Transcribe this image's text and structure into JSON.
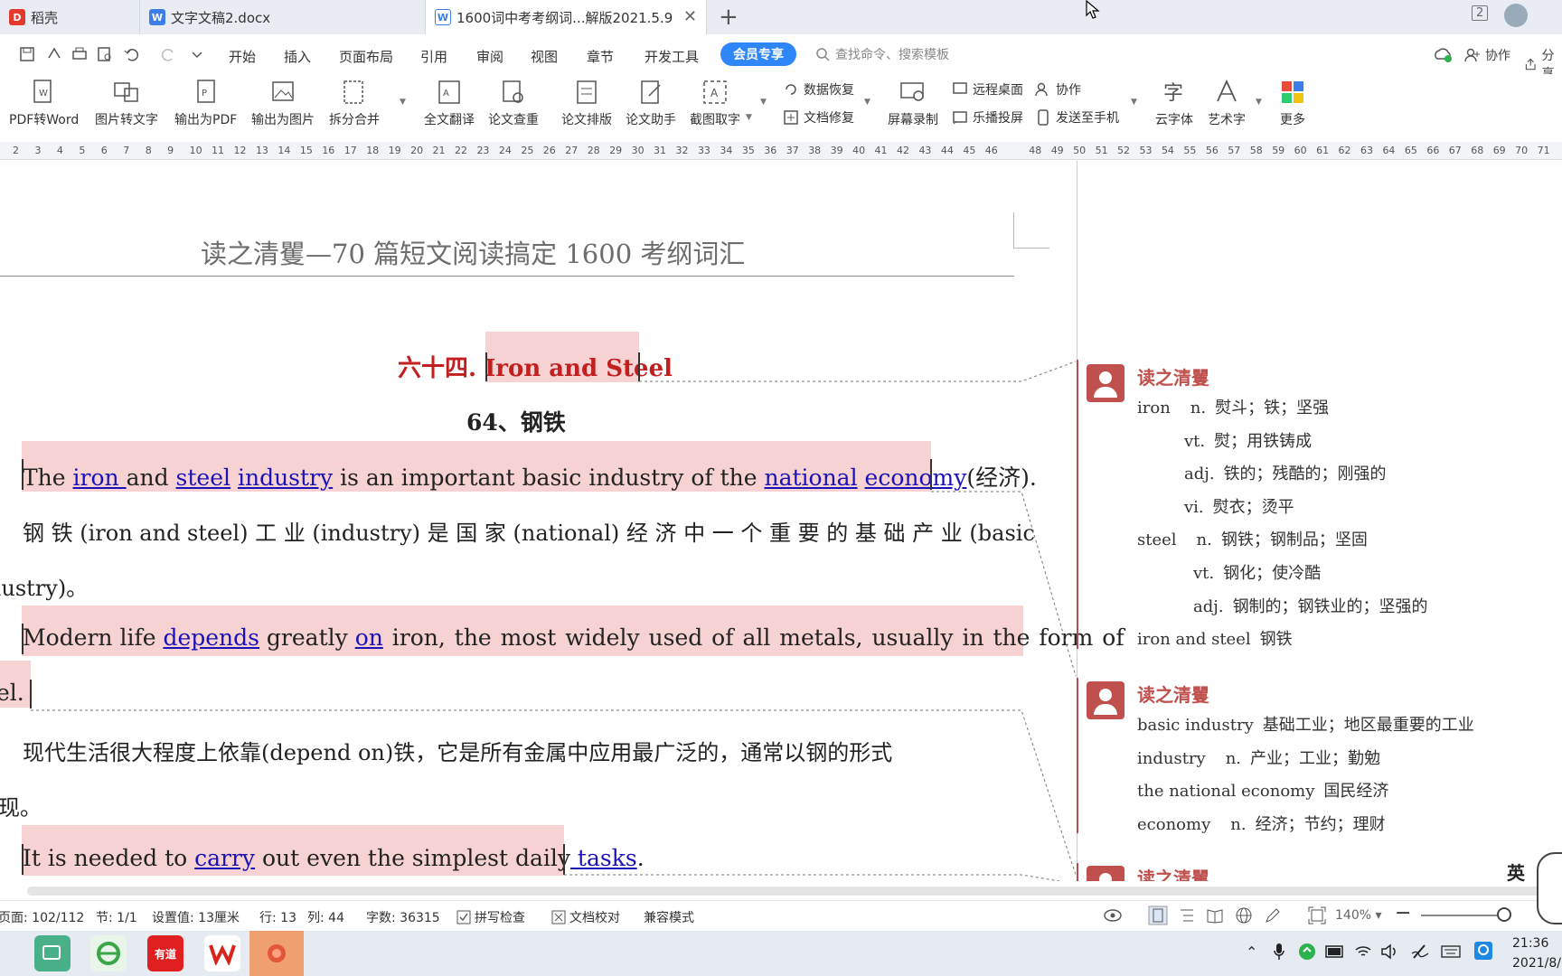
{
  "tabs": [
    {
      "label": "稻壳",
      "icon": "docer-icon"
    },
    {
      "label": "文字文稿2.docx",
      "icon": "word-doc-icon"
    },
    {
      "label": "1600词中考考纲词...解版2021.5.9",
      "icon": "word-doc-icon"
    }
  ],
  "window": {
    "page_count_badge": "2"
  },
  "menu": {
    "items": [
      "开始",
      "插入",
      "页面布局",
      "引用",
      "审阅",
      "视图",
      "章节",
      "开发工具"
    ],
    "vip": "会员专享",
    "search_placeholder": "查找命令、搜索模板",
    "collab": "协作",
    "share": "分享"
  },
  "ribbon": {
    "big": [
      "PDF转Word",
      "图片转文字",
      "输出为PDF",
      "输出为图片",
      "拆分合并",
      "全文翻译",
      "论文查重",
      "论文排版",
      "论文助手",
      "截图取字",
      "屏幕录制",
      "云字体",
      "艺术字",
      "更多"
    ],
    "small": [
      "数据恢复",
      "文档修复",
      "远程桌面",
      "乐播投屏",
      "协作",
      "发送至手机"
    ]
  },
  "ruler": [
    "2",
    "3",
    "4",
    "5",
    "6",
    "7",
    "8",
    "9",
    "10",
    "11",
    "12",
    "13",
    "14",
    "15",
    "16",
    "17",
    "18",
    "19",
    "20",
    "21",
    "22",
    "23",
    "24",
    "25",
    "26",
    "27",
    "28",
    "29",
    "30",
    "31",
    "32",
    "33",
    "34",
    "35",
    "36",
    "37",
    "38",
    "39",
    "40",
    "41",
    "42",
    "43",
    "44",
    "45",
    "46",
    "48",
    "49",
    "50",
    "51",
    "52",
    "53",
    "54",
    "55",
    "56",
    "57",
    "58",
    "59",
    "60",
    "61",
    "62",
    "63",
    "64",
    "65",
    "66",
    "67",
    "68",
    "69",
    "70",
    "71"
  ],
  "doc": {
    "header": "读之清矍—70 篇短文阅读搞定 1600 考纲词汇",
    "title_prefix": "六十四.",
    "title_en": "Iron and Steel",
    "subtitle": "64、钢铁",
    "p1": {
      "t1": "The ",
      "l1": "iron ",
      "t2": "and ",
      "l2": "steel",
      "t3": " ",
      "l3": "industry",
      "t4": " is an important basic industry of the ",
      "l4": "national",
      "t5": " ",
      "l5": "economy",
      "t6": "(经济)."
    },
    "p1_cn_1": "钢 铁 (iron  and  steel) 工 业 (industry) 是 国 家 (national) 经 济 中 一 个 重 要 的 基 础 产 业 (basic",
    "p1_cn_2": "dustry)。",
    "p2": {
      "t1": "Modern life ",
      "l1": "depends",
      "t2": " greatly ",
      "l2": "on",
      "t3": " iron, the most widely used of all metals, usually in the form of"
    },
    "p2_end": "el.",
    "p2_cn_1": "现代生活很大程度上依靠(depend on)铁，它是所有金属中应用最广泛的，通常以钢的形式",
    "p2_cn_2": "现。",
    "p3": {
      "t1": "It is needed to ",
      "l1": "carry",
      "t2": " out even the simplest daily",
      "l2": " tasks",
      "t3": "."
    }
  },
  "comments": [
    {
      "author": "读之清矍",
      "rows": [
        {
          "word": "iron",
          "pos": "n.",
          "def": "熨斗；铁；坚强"
        },
        {
          "word": "",
          "pos": "vt.",
          "def": "熨；用铁铸成"
        },
        {
          "word": "",
          "pos": "adj.",
          "def": "铁的；残酷的；刚强的"
        },
        {
          "word": "",
          "pos": "vi.",
          "def": "熨衣；烫平"
        },
        {
          "word": "steel",
          "pos": "n.",
          "def": "钢铁；钢制品；坚固"
        },
        {
          "word": "",
          "pos": "vt.",
          "def": "钢化；使冷酷"
        },
        {
          "word": "",
          "pos": "adj.",
          "def": "钢制的；钢铁业的；坚强的"
        },
        {
          "word": "iron and steel",
          "pos": "",
          "def": "钢铁"
        }
      ]
    },
    {
      "author": "读之清矍",
      "rows": [
        {
          "word": "basic industry",
          "pos": "",
          "def": "基础工业；地区最重要的工业"
        },
        {
          "word": "industry",
          "pos": "n.",
          "def": "产业；工业；勤勉"
        },
        {
          "word": "the national economy",
          "pos": "",
          "def": "国民经济"
        },
        {
          "word": "economy",
          "pos": "n.",
          "def": "经济；节约；理财"
        }
      ]
    },
    {
      "author": "读之清矍",
      "rows": []
    }
  ],
  "status": {
    "page": "页面: 102/112",
    "section": "节: 1/1",
    "setting": "设置值: 13厘米",
    "row": "行: 13",
    "col": "列: 44",
    "words": "字数: 36315",
    "spell": "拼写检查",
    "proof": "文档校对",
    "compat": "兼容模式",
    "zoom": "140%"
  },
  "ime": "英",
  "clock": {
    "time": "21:36",
    "date": "2021/8/"
  },
  "taskbar": {
    "youdao": "有道"
  }
}
